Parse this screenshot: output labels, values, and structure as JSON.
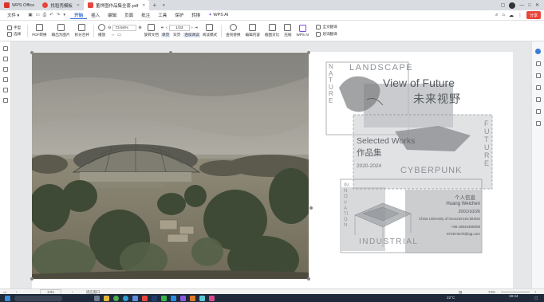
{
  "tabs": [
    {
      "label": "WPS Office",
      "color": "#d9342b"
    },
    {
      "label": "找稻壳模板",
      "color": "#e8453c"
    },
    {
      "label": "董烨图作品集全套.pdf",
      "color": "#e8453c",
      "active": true
    }
  ],
  "window_buttons": {
    "minimize": "—",
    "maximize": "□",
    "close": "✕"
  },
  "menu": {
    "file": "文件",
    "items": [
      "开始",
      "插入",
      "编辑",
      "页面",
      "批注",
      "工具",
      "保护",
      "转换",
      "WPS AI"
    ],
    "active_index": 0,
    "share": "分享"
  },
  "toolbar": {
    "hand": "手型",
    "select": "选择",
    "pdf_convert": "PDF转换",
    "output_image": "输出为图片",
    "split_merge": "拆分合并",
    "play": "播放",
    "zoom_value": "73.84%",
    "rotate": "旋转文档",
    "single_page": "单页",
    "double_page": "双页",
    "continuous": "连续阅读",
    "page_value": "1/33",
    "read_mode": "阅读模式",
    "find_replace": "查找替换",
    "edit_content": "编辑内容",
    "screenshot_compare": "截图对比",
    "compress": "压缩",
    "wps_ai": "WPS AI",
    "full_translate": "全文翻译",
    "word_translate": "划词翻译"
  },
  "design": {
    "nature": "NATURE",
    "landscape": "LANDSCAPE",
    "title_en": "View of Future",
    "title_cn": "未来视野",
    "selected": "Selected Works",
    "portfolio": "作品集",
    "years": "2020-2024",
    "future": "FUTURE",
    "cyberpunk": "CYBERPUNK",
    "innovation": "INNOVATION",
    "industrial": "INDUSTRIAL",
    "info_label": "个人信息",
    "name": "Huang Weichen",
    "date": "2001/10/26",
    "university": "China University of Geosciences,Wuhan",
    "phone": "+86 18644465008",
    "email": "872673478@qq.com"
  },
  "status": {
    "page": "1/33",
    "fit_label": "适应窗口",
    "zoom": "74%"
  },
  "taskbar": {
    "temp": "22°C",
    "time": "19:44",
    "date": "2024/3/28"
  },
  "colors": {
    "accent": "#2a6bd8",
    "wps_red": "#e8453c",
    "design_text": "#6e7378",
    "taskbar_bg": "#1f2a3a"
  }
}
